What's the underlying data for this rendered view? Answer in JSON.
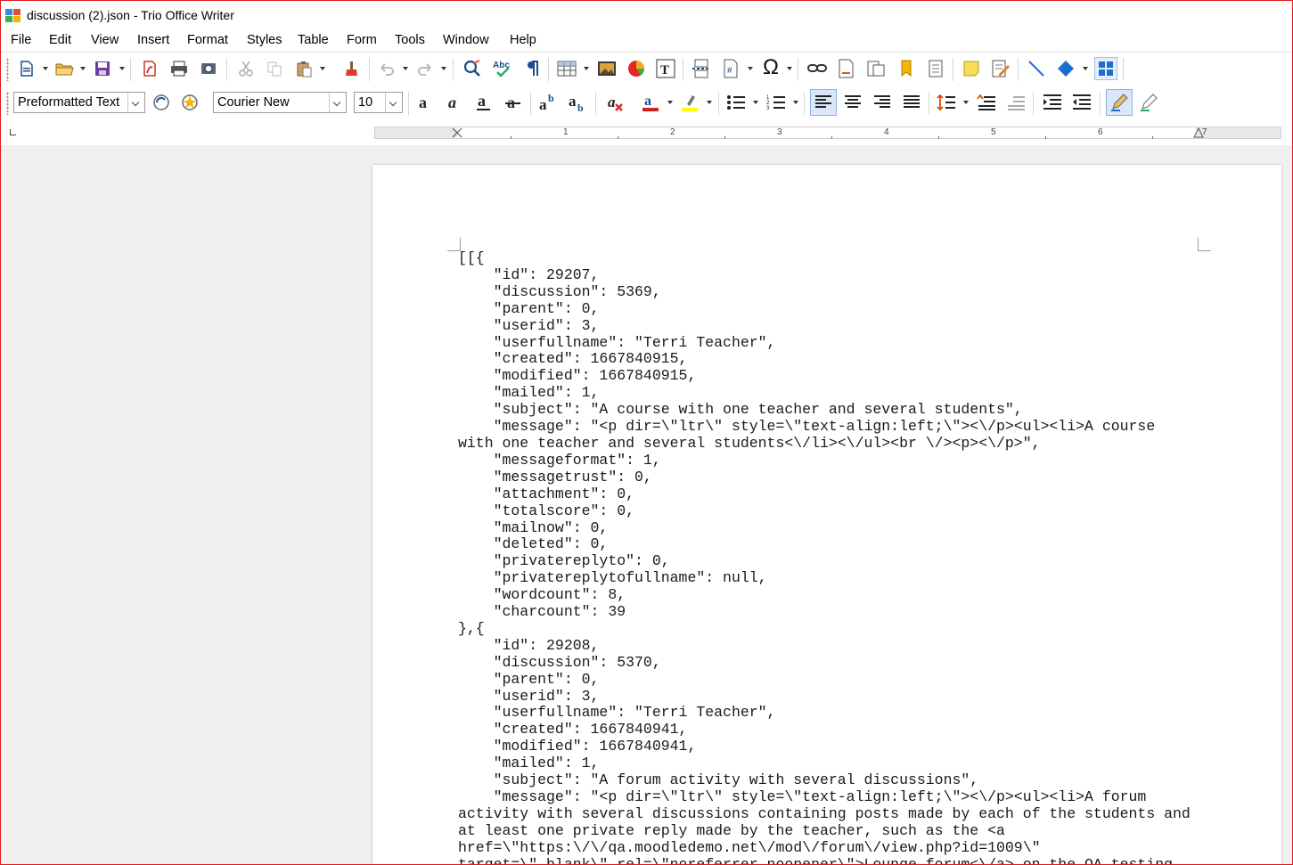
{
  "window": {
    "title": "discussion (2).json - Trio Office Writer"
  },
  "menu": {
    "items": [
      "File",
      "Edit",
      "View",
      "Insert",
      "Format",
      "Styles",
      "Table",
      "Form",
      "Tools",
      "Window",
      "Help"
    ]
  },
  "toolbar2": {
    "paragraph_style": "Preformatted Text",
    "font_name": "Courier New",
    "font_size": "10"
  },
  "ruler": {
    "numbers": [
      "1",
      "2",
      "3",
      "4",
      "5",
      "6",
      "7"
    ]
  },
  "document": {
    "lines": [
      "[[{",
      "    \"id\": 29207,",
      "    \"discussion\": 5369,",
      "    \"parent\": 0,",
      "    \"userid\": 3,",
      "    \"userfullname\": \"Terri Teacher\",",
      "    \"created\": 1667840915,",
      "    \"modified\": 1667840915,",
      "    \"mailed\": 1,",
      "    \"subject\": \"A course with one teacher and several students\",",
      "    \"message\": \"<p dir=\\\"ltr\\\" style=\\\"text-align:left;\\\"><\\/p><ul><li>A course",
      "with one teacher and several students<\\/li><\\/ul><br \\/><p><\\/p>\",",
      "    \"messageformat\": 1,",
      "    \"messagetrust\": 0,",
      "    \"attachment\": 0,",
      "    \"totalscore\": 0,",
      "    \"mailnow\": 0,",
      "    \"deleted\": 0,",
      "    \"privatereplyto\": 0,",
      "    \"privatereplytofullname\": null,",
      "    \"wordcount\": 8,",
      "    \"charcount\": 39",
      "},{",
      "    \"id\": 29208,",
      "    \"discussion\": 5370,",
      "    \"parent\": 0,",
      "    \"userid\": 3,",
      "    \"userfullname\": \"Terri Teacher\",",
      "    \"created\": 1667840941,",
      "    \"modified\": 1667840941,",
      "    \"mailed\": 1,",
      "    \"subject\": \"A forum activity with several discussions\",",
      "    \"message\": \"<p dir=\\\"ltr\\\" style=\\\"text-align:left;\\\"><\\/p><ul><li>A forum",
      "activity with several discussions containing posts made by each of the students and",
      "at least one private reply made by the teacher, such as the <a",
      "href=\\\"https:\\/\\/qa.moodledemo.net\\/mod\\/forum\\/view.php?id=1009\\\"",
      "target=\\\"_blank\\\" rel=\\\"noreferrer noopener\\\">Lounge forum<\\/a> on the QA testing"
    ]
  }
}
